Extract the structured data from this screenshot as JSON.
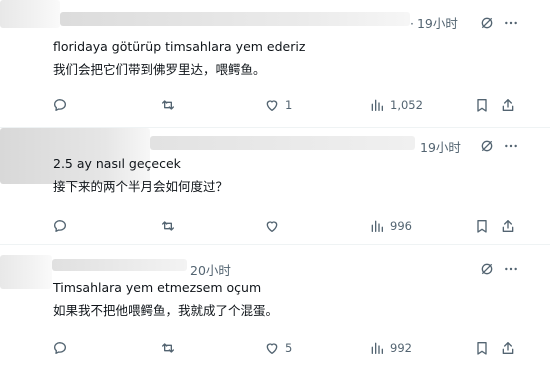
{
  "replies": [
    {
      "time": "19小时",
      "text_original": "floridaya götürüp timsahlara yem ederiz",
      "text_translated": "我们会把它们带到佛罗里达，喂鳄鱼。",
      "actions": {
        "reply_count": "",
        "repost_count": "",
        "like_count": "1",
        "views": "1,052"
      }
    },
    {
      "time": "19小时",
      "text_original": "2.5 ay nasıl geçecek",
      "text_translated": "接下来的两个半月会如何度过？",
      "actions": {
        "reply_count": "",
        "repost_count": "",
        "like_count": "",
        "views": "996"
      }
    },
    {
      "time": "20小时",
      "text_original": "Timsahlara yem etmezsem oçum",
      "text_translated": "如果我不把他喂鳄鱼，我就成了个混蛋。",
      "actions": {
        "reply_count": "",
        "repost_count": "",
        "like_count": "5",
        "views": "992"
      }
    }
  ],
  "icons": {
    "reply": "speech-bubble-icon",
    "repost": "repost-icon",
    "like": "heart-icon",
    "views": "views-bar-chart-icon",
    "bookmark": "bookmark-icon",
    "share": "share-icon",
    "grok": "grok-icon",
    "more": "more-icon"
  },
  "colors": {
    "text": "#0f1419",
    "secondary": "#536471",
    "divider": "#eff3f4"
  }
}
